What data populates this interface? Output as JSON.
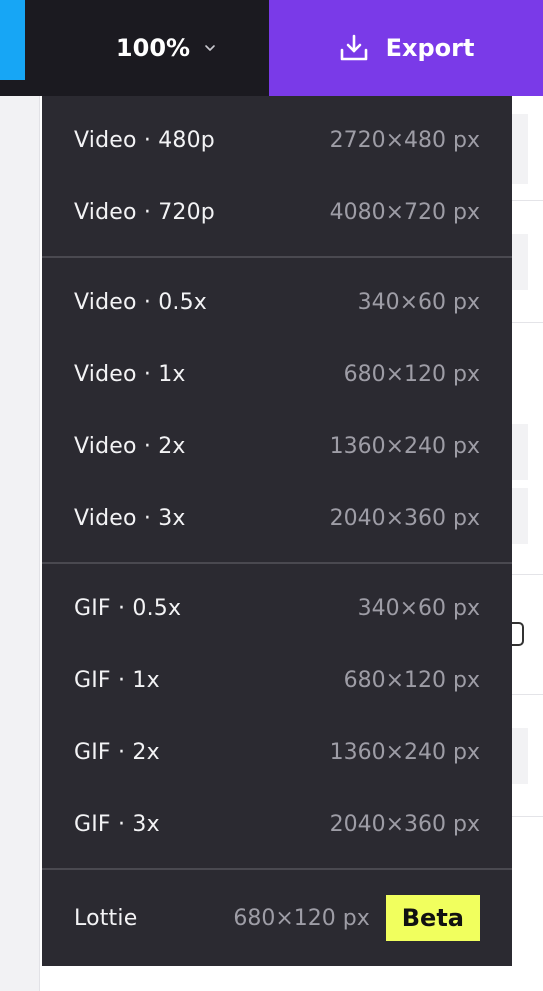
{
  "toolbar": {
    "zoom_label": "100%",
    "export_label": "Export"
  },
  "menu": {
    "groups": [
      [
        {
          "label": "Video · 480p",
          "dims": "2720×480 px"
        },
        {
          "label": "Video · 720p",
          "dims": "4080×720 px"
        }
      ],
      [
        {
          "label": "Video · 0.5x",
          "dims": "340×60 px"
        },
        {
          "label": "Video · 1x",
          "dims": "680×120 px"
        },
        {
          "label": "Video · 2x",
          "dims": "1360×240 px"
        },
        {
          "label": "Video · 3x",
          "dims": "2040×360 px"
        }
      ],
      [
        {
          "label": "GIF · 0.5x",
          "dims": "340×60 px"
        },
        {
          "label": "GIF · 1x",
          "dims": "680×120 px"
        },
        {
          "label": "GIF · 2x",
          "dims": "1360×240 px"
        },
        {
          "label": "GIF · 3x",
          "dims": "2040×360 px"
        }
      ],
      [
        {
          "label": "Lottie",
          "dims": "680×120 px",
          "badge": "Beta"
        }
      ]
    ]
  },
  "colors": {
    "accent": "#7a3ae8",
    "menu_bg": "#2b2a31",
    "badge_bg": "#f1ff5e",
    "selection_blue": "#17a6f5"
  }
}
